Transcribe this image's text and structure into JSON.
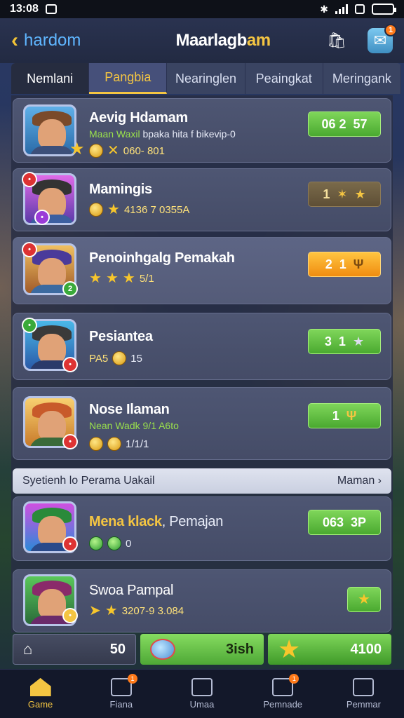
{
  "status": {
    "time": "13:08"
  },
  "header": {
    "back_label": "hardom",
    "title_left": "Maarlagb",
    "title_right": "am",
    "mail_badge": "1"
  },
  "tabs": [
    {
      "label": "Nemlani"
    },
    {
      "label": "Pangbia"
    },
    {
      "label": "Nearinglen"
    },
    {
      "label": "Peaingkat"
    },
    {
      "label": "Meringank"
    }
  ],
  "players": [
    {
      "name": "Aevig Hdamam",
      "sub_green": "Maan Waxil",
      "sub_rest": "bpaka hita f bikevip-0",
      "meta": "060- 801",
      "score_a": "06 2",
      "score_b": "57"
    },
    {
      "name": "Mamingis",
      "meta": "4136 7 0355A",
      "score_a": "1",
      "score_b": ""
    },
    {
      "name": "Penoinhgalg Pemakah",
      "meta": "5/1",
      "score_a": "2",
      "score_b": "1"
    },
    {
      "name": "Pesiantea",
      "meta_prefix": "PA5",
      "meta": "15",
      "score_a": "3",
      "score_b": "1"
    },
    {
      "name": "Nose Ilaman",
      "sub_green": "Nean Wadk 9/1 A6to",
      "meta": "1/1/1",
      "score_a": "1",
      "score_b": ""
    },
    {
      "name": "Mena klack",
      "name_extra": ", Pemajan",
      "meta": "0",
      "score_a": "063",
      "score_b": "3P"
    },
    {
      "name": "Swoa Pampal",
      "meta": "3207-9 3.084",
      "score_a": "",
      "score_b": ""
    }
  ],
  "section": {
    "title": "Syetienh lo Perama Uakail",
    "link": "Maman ›"
  },
  "actions": {
    "home_count": "50",
    "mid_label": "3ish",
    "right_value": "4100"
  },
  "nav": [
    {
      "label": "Game",
      "icon": "home-icon"
    },
    {
      "label": "Fiana",
      "icon": "chat-icon",
      "badge": "1"
    },
    {
      "label": "Umaa",
      "icon": "tv-icon"
    },
    {
      "label": "Pemnade",
      "icon": "mail-icon",
      "badge": "1"
    },
    {
      "label": "Pemmar",
      "icon": "profile-icon"
    }
  ],
  "colors": {
    "accent": "#f4c542",
    "green": "#5cbd3a",
    "orange": "#f39a1a"
  }
}
